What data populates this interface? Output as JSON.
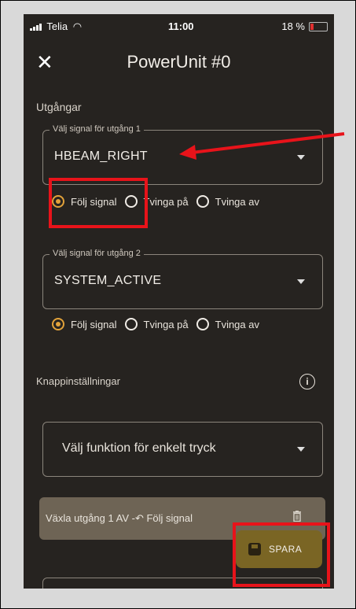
{
  "status": {
    "carrier": "Telia",
    "time": "11:00",
    "battery": "18 %",
    "battery_color": "#e03030"
  },
  "header": {
    "title": "PowerUnit #0",
    "close_icon": "close-icon"
  },
  "outputs": {
    "section_label": "Utgångar",
    "output1": {
      "label": "Välj signal för utgång 1",
      "value": "HBEAM_RIGHT"
    },
    "output2": {
      "label": "Välj signal för utgång 2",
      "value": "SYSTEM_ACTIVE"
    },
    "radio_options": [
      "Följ signal",
      "Tvinga på",
      "Tvinga av"
    ],
    "output1_selected": "Följ signal",
    "output2_selected": "Följ signal"
  },
  "buttons": {
    "section_label": "Knappinställningar",
    "info_icon": "i",
    "function_placeholder": "Välj funktion för enkelt tryck",
    "rule_text": "Växla utgång 1 AV -↶ Följ signal"
  },
  "fab": {
    "label": "SPARA"
  },
  "colors": {
    "accent": "#e2a23a",
    "background": "#262320",
    "annotation": "#e8131a"
  }
}
